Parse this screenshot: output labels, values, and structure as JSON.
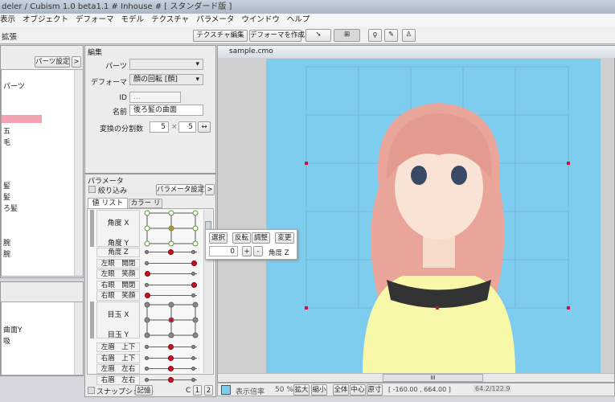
{
  "title": "deler / Cubism 1.0 beta1.1 # Inhouse #  [ スタンダード版 ]",
  "menu": [
    "表示",
    "オブジェクト",
    "デフォーマ",
    "モデル",
    "テクスチャ",
    "パラメータ",
    "ウインドウ",
    "ヘルプ"
  ],
  "toolbar": {
    "label": "拡張",
    "texture_edit": "テクスチャ編集",
    "create_deformer": "デフォーマを作成"
  },
  "parts_panel": {
    "settings_button": "パーツ設定",
    "more_button": ">",
    "items": [
      "パーツ",
      "",
      "",
      "",
      "五",
      "毛",
      "",
      "",
      "",
      "髪",
      "髪",
      "ろ髪",
      "",
      "",
      "腕",
      "腕"
    ],
    "lower_items": [
      "曲面Y",
      "吸"
    ]
  },
  "edit_panel": {
    "header": "編集",
    "parts_label": "パーツ",
    "parts_value": "",
    "deformer_label": "デフォーマ",
    "deformer_value": "顔の回転 [顔]",
    "id_label": "ID",
    "id_value": "...",
    "name_label": "名前",
    "name_value": "後ろ髪の曲面",
    "divisions_label": "変換の分割数",
    "div_x": "5",
    "times": "×",
    "div_y": "5"
  },
  "param_panel": {
    "header": "パラメータ",
    "filter_label": "絞り込み",
    "settings_button": "パラメータ設定",
    "more_button": ">",
    "tabs": [
      "値 リスト",
      "カラー リスト"
    ],
    "grid1": [
      "角度 X",
      "角度 Y"
    ],
    "sliders1": [
      {
        "label": "角度 Z",
        "pos": 0.5
      },
      {
        "label": "左眼　開閉",
        "pos": 1
      },
      {
        "label": "左眼　笑顔",
        "pos": 0
      },
      {
        "label": "右眼　開閉",
        "pos": 1
      },
      {
        "label": "右眼　笑顔",
        "pos": 0
      }
    ],
    "grid2": [
      "目玉 X",
      "目玉 Y"
    ],
    "sliders2": [
      {
        "label": "左眉　上下",
        "pos": 0.5
      },
      {
        "label": "右眉　上下",
        "pos": 0.5
      },
      {
        "label": "左眉　左右",
        "pos": 0.5
      },
      {
        "label": "右眉　左右",
        "pos": 0.5
      }
    ],
    "snapshot_label": "スナップショット",
    "store_button": "記憶",
    "c_label": "C",
    "page1": "1",
    "page2": "2"
  },
  "popup": {
    "select": "選択",
    "flip": "反転",
    "adjust": "調整",
    "change": "変更",
    "value": "0",
    "plus": "+",
    "minus": "-",
    "param": "角度 Z"
  },
  "canvas": {
    "tab": "sample.cmo",
    "bg_color": "#7ecdee"
  },
  "status": {
    "zoom_label": "表示倍率",
    "zoom_value": "50 %",
    "zoom_in": "拡大",
    "zoom_out": "縮小",
    "fit": "全体",
    "center": "中心",
    "actual": "原寸",
    "coords": "[ -160.00 , 664.00 ]",
    "extra": "64.2/122.9",
    "scroll_grip": "III"
  }
}
